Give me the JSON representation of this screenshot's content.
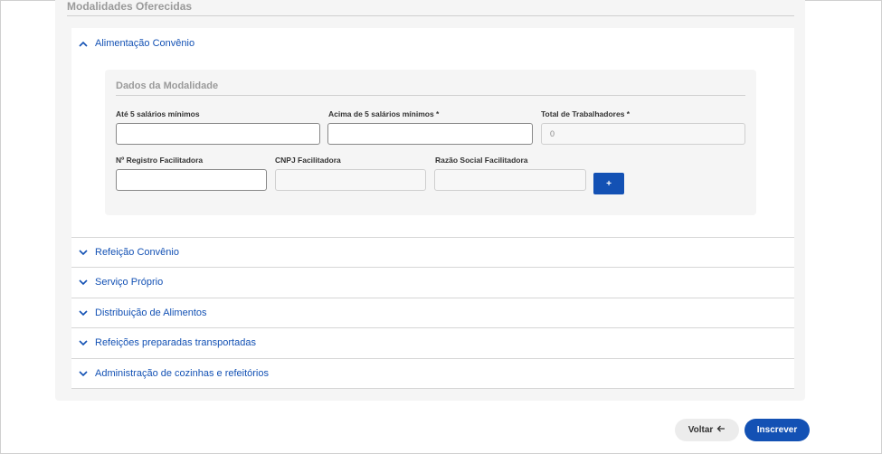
{
  "section": {
    "title": "Modalidades Oferecidas"
  },
  "accordion": {
    "expanded": {
      "label": "Alimentação Convênio",
      "inner_title": "Dados da Modalidade",
      "fields": {
        "ate5_label": "Até 5 salários mínimos",
        "ate5_value": "",
        "acima5_label": "Acima de 5 salários mínimos *",
        "acima5_value": "",
        "total_label": "Total de Trabalhadores *",
        "total_value": "0",
        "registro_label": "Nº Registro Facilitadora",
        "registro_value": "",
        "cnpj_label": "CNPJ Facilitadora",
        "cnpj_value": "",
        "razao_label": "Razão Social Facilitadora",
        "razao_value": ""
      },
      "add_label": "+"
    },
    "items": [
      {
        "label": "Refeição Convênio"
      },
      {
        "label": "Serviço Próprio"
      },
      {
        "label": "Distribuição de Alimentos"
      },
      {
        "label": "Refeições preparadas transportadas"
      },
      {
        "label": "Administração de cozinhas e refeitórios"
      }
    ]
  },
  "actions": {
    "back_label": "Voltar",
    "submit_label": "Inscrever"
  },
  "colors": {
    "primary": "#1351b4",
    "muted": "#9a9a9a"
  }
}
